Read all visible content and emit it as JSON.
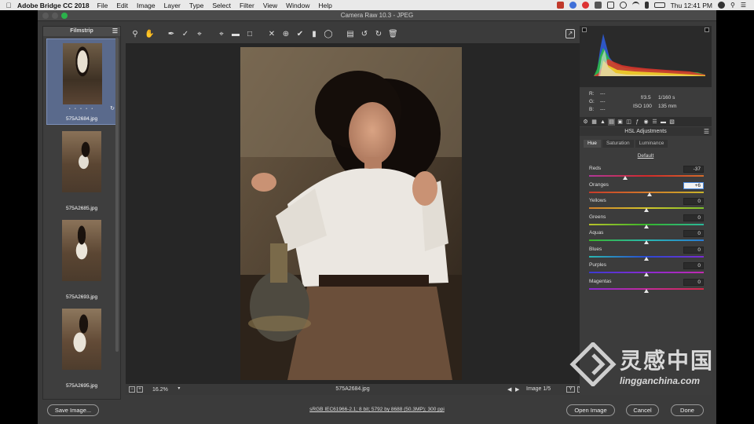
{
  "menubar": {
    "app_name": "Adobe Bridge CC 2018",
    "items": [
      "File",
      "Edit",
      "Image",
      "Layer",
      "Type",
      "Select",
      "Filter",
      "View",
      "Window",
      "Help"
    ],
    "clock": "Thu 12:41 PM"
  },
  "window": {
    "title": "Camera Raw 10.3  -  JPEG"
  },
  "filmstrip": {
    "title": "Filmstrip",
    "items": [
      {
        "filename": "575A2684.jpg",
        "selected": true,
        "stars": "• • • • •"
      },
      {
        "filename": "575A2685.jpg"
      },
      {
        "filename": "575A2693.jpg"
      },
      {
        "filename": "575A2695.jpg"
      }
    ]
  },
  "canvas": {
    "zoom": "16.2%",
    "filename": "575A2684.jpg",
    "image_counter": "Image 1/5",
    "y_label": "Y"
  },
  "readout": {
    "r_label": "R:",
    "r_value": "---",
    "g_label": "G:",
    "g_value": "---",
    "b_label": "B:",
    "b_value": "---",
    "aperture": "f/3.5",
    "shutter": "1/160 s",
    "iso": "ISO 100",
    "focal": "135 mm"
  },
  "hsl": {
    "title": "HSL Adjustments",
    "tabs": [
      "Hue",
      "Saturation",
      "Luminance"
    ],
    "active_tab": "Hue",
    "default_label": "Default",
    "sliders": [
      {
        "name": "Reds",
        "value": "-37",
        "level": 0.315,
        "gradient": "linear-gradient(90deg,#b0389a,#d22a2a,#d26a2a)"
      },
      {
        "name": "Oranges",
        "value": "+6",
        "level": 0.53,
        "gradient": "linear-gradient(90deg,#c73a2a,#d2792a,#c9b42a)",
        "editing": true
      },
      {
        "name": "Yellows",
        "value": "0",
        "level": 0.5,
        "gradient": "linear-gradient(90deg,#d2802a,#d2c52a,#7cc22a)"
      },
      {
        "name": "Greens",
        "value": "0",
        "level": 0.5,
        "gradient": "linear-gradient(90deg,#b9c22a,#36b52a,#2ab89a)"
      },
      {
        "name": "Aquas",
        "value": "0",
        "level": 0.5,
        "gradient": "linear-gradient(90deg,#3ab52a,#2ab8b0,#2a7ad2)"
      },
      {
        "name": "Blues",
        "value": "0",
        "level": 0.5,
        "gradient": "linear-gradient(90deg,#2ab8b0,#2a4ad2,#7a2ad2)"
      },
      {
        "name": "Purples",
        "value": "0",
        "level": 0.5,
        "gradient": "linear-gradient(90deg,#3a3ad2,#8a2ad2,#c22ab0)"
      },
      {
        "name": "Magentas",
        "value": "0",
        "level": 0.5,
        "gradient": "linear-gradient(90deg,#8a2ad2,#c22a9a,#d22a4a)"
      }
    ]
  },
  "bottom": {
    "save_label": "Save Image...",
    "workflow": "sRGB IEC61966-2.1; 8 bit; 5792 by 8688 (50.3MP); 300 ppi",
    "open_label": "Open Image",
    "cancel_label": "Cancel",
    "done_label": "Done"
  },
  "watermark": {
    "cn": "灵感中国",
    "url": "lingganchina.com"
  },
  "colors": {
    "accent": "#4c8bdf",
    "panel": "#3c3c3c",
    "canvas": "#262626",
    "selected_thumb": "#5a6a8c"
  }
}
